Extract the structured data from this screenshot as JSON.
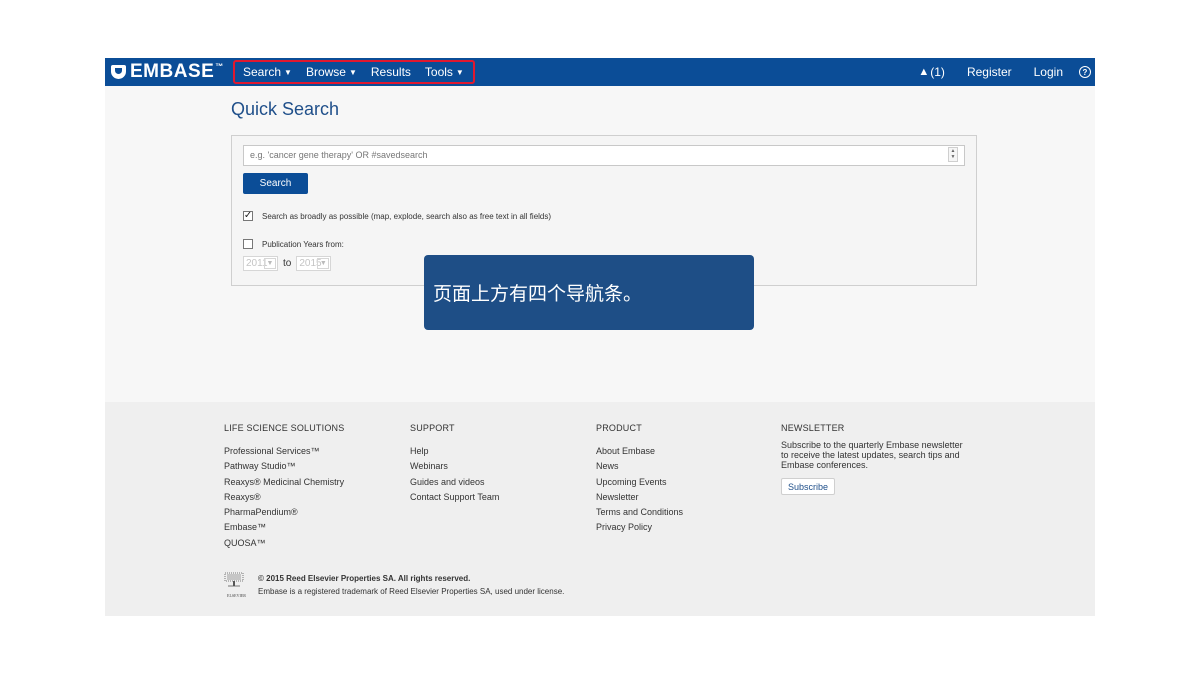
{
  "brand": {
    "logo_text": "EMBASE",
    "tm": "™",
    "nav_color": "#0b4d97",
    "highlight_color": "#e0182f"
  },
  "topnav": {
    "items": [
      {
        "label": "Search",
        "has_caret": true
      },
      {
        "label": "Browse",
        "has_caret": true
      },
      {
        "label": "Results",
        "has_caret": false
      },
      {
        "label": "Tools",
        "has_caret": true
      }
    ],
    "alerts_label": "(1)",
    "register_label": "Register",
    "login_label": "Login",
    "help_icon": "question-circle-icon"
  },
  "quick_search": {
    "title": "Quick Search",
    "placeholder": "e.g. 'cancer gene therapy' OR #savedsearch",
    "search_button": "Search",
    "broad_search_label": "Search as broadly as possible (map, explode, search also as free text in all fields)",
    "broad_search_checked": true,
    "pub_years_label": "Publication Years from:",
    "pub_years_checked": false,
    "year_from": "2011",
    "year_to": "2015",
    "to_label": "to"
  },
  "tooltip": {
    "text": "页面上方有四个导航条。"
  },
  "footer": {
    "life_science": {
      "heading": "LIFE SCIENCE SOLUTIONS",
      "items": [
        "Professional Services™",
        "Pathway Studio™",
        "Reaxys® Medicinal Chemistry",
        "Reaxys®",
        "PharmaPendium®",
        "Embase™",
        "QUOSA™"
      ]
    },
    "support": {
      "heading": "SUPPORT",
      "items": [
        "Help",
        "Webinars",
        "Guides and videos",
        "Contact Support Team"
      ]
    },
    "product": {
      "heading": "PRODUCT",
      "items": [
        "About Embase",
        "News",
        "Upcoming Events",
        "Newsletter",
        "Terms and Conditions",
        "Privacy Policy"
      ]
    },
    "newsletter": {
      "heading": "NEWSLETTER",
      "text": "Subscribe to the quarterly Embase newsletter to receive the latest updates, search tips and Embase conferences.",
      "button": "Subscribe"
    },
    "copyright": "© 2015 Reed Elsevier Properties SA. All rights reserved.",
    "trademark": "Embase is a registered trademark of Reed Elsevier Properties SA, used under license.",
    "elsevier_word": "ELSEVIER"
  }
}
